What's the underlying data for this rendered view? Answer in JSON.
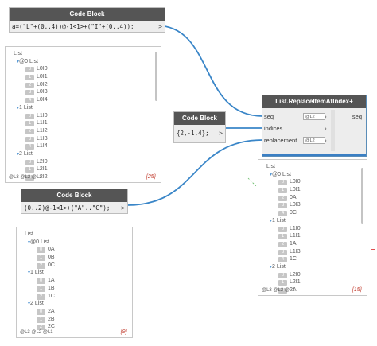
{
  "nodes": {
    "cb1": {
      "title": "Code Block",
      "code": "a=(\"L\"+(0..4))@-1<1>+(\"I\"+(0..4));",
      "output_arrow": ">",
      "preview": {
        "rows": [
          {
            "kind": "list",
            "level": 0,
            "label": "List",
            "index": ""
          },
          {
            "kind": "list",
            "level": 1,
            "label": "List",
            "index": "@0"
          },
          {
            "kind": "item",
            "level": 2,
            "index": "0",
            "value": "L0I0"
          },
          {
            "kind": "item",
            "level": 2,
            "index": "1",
            "value": "L0I1"
          },
          {
            "kind": "item",
            "level": 2,
            "index": "2",
            "value": "L0I2"
          },
          {
            "kind": "item",
            "level": 2,
            "index": "3",
            "value": "L0I3"
          },
          {
            "kind": "item",
            "level": 2,
            "index": "4",
            "value": "L0I4"
          },
          {
            "kind": "list",
            "level": 1,
            "label": "List",
            "index": "1"
          },
          {
            "kind": "item",
            "level": 2,
            "index": "0",
            "value": "L1I0"
          },
          {
            "kind": "item",
            "level": 2,
            "index": "1",
            "value": "L1I1"
          },
          {
            "kind": "item",
            "level": 2,
            "index": "2",
            "value": "L1I2"
          },
          {
            "kind": "item",
            "level": 2,
            "index": "3",
            "value": "L1I3"
          },
          {
            "kind": "item",
            "level": 2,
            "index": "4",
            "value": "L1I4"
          },
          {
            "kind": "list",
            "level": 1,
            "label": "List",
            "index": "2"
          },
          {
            "kind": "item",
            "level": 2,
            "index": "0",
            "value": "L2I0"
          },
          {
            "kind": "item",
            "level": 2,
            "index": "1",
            "value": "L2I1"
          },
          {
            "kind": "item",
            "level": 2,
            "index": "2",
            "value": "L2I2"
          }
        ],
        "levels": "@L3 @L2 @L1",
        "count": "{25}"
      }
    },
    "cb2": {
      "title": "Code Block",
      "code": "{2,-1,4};",
      "output_arrow": ">"
    },
    "cb3": {
      "title": "Code Block",
      "code": "(0..2)@-1<1>+(\"A\"..\"C\");",
      "output_arrow": ">",
      "preview": {
        "rows": [
          {
            "kind": "list",
            "level": 0,
            "label": "List",
            "index": ""
          },
          {
            "kind": "list",
            "level": 1,
            "label": "List",
            "index": "@0"
          },
          {
            "kind": "item",
            "level": 2,
            "index": "0",
            "value": "0A"
          },
          {
            "kind": "item",
            "level": 2,
            "index": "1",
            "value": "0B"
          },
          {
            "kind": "item",
            "level": 2,
            "index": "2",
            "value": "0C"
          },
          {
            "kind": "list",
            "level": 1,
            "label": "List",
            "index": "1"
          },
          {
            "kind": "item",
            "level": 2,
            "index": "0",
            "value": "1A"
          },
          {
            "kind": "item",
            "level": 2,
            "index": "1",
            "value": "1B"
          },
          {
            "kind": "item",
            "level": 2,
            "index": "2",
            "value": "1C"
          },
          {
            "kind": "list",
            "level": 1,
            "label": "List",
            "index": "2"
          },
          {
            "kind": "item",
            "level": 2,
            "index": "0",
            "value": "2A"
          },
          {
            "kind": "item",
            "level": 2,
            "index": "1",
            "value": "2B"
          },
          {
            "kind": "item",
            "level": 2,
            "index": "2",
            "value": "2C"
          }
        ],
        "levels": "@L3 @L2 @L1",
        "count": "{9}"
      }
    },
    "replace": {
      "title": "List.ReplaceItemAtIndex+",
      "inputs": [
        {
          "name": "seq",
          "lacing": "@L2"
        },
        {
          "name": "indices",
          "lacing": ""
        },
        {
          "name": "replacement",
          "lacing": "@L2"
        }
      ],
      "output": "seq",
      "preview": {
        "rows": [
          {
            "kind": "list",
            "level": 0,
            "label": "List",
            "index": ""
          },
          {
            "kind": "list",
            "level": 1,
            "label": "List",
            "index": "@0"
          },
          {
            "kind": "item",
            "level": 2,
            "index": "0",
            "value": "L0I0"
          },
          {
            "kind": "item",
            "level": 2,
            "index": "1",
            "value": "L0I1"
          },
          {
            "kind": "item",
            "level": 2,
            "index": "2",
            "value": "0A"
          },
          {
            "kind": "item",
            "level": 2,
            "index": "3",
            "value": "L0I3"
          },
          {
            "kind": "item",
            "level": 2,
            "index": "4",
            "value": "0C"
          },
          {
            "kind": "list",
            "level": 1,
            "label": "List",
            "index": "1"
          },
          {
            "kind": "item",
            "level": 2,
            "index": "0",
            "value": "L1I0"
          },
          {
            "kind": "item",
            "level": 2,
            "index": "1",
            "value": "L1I1"
          },
          {
            "kind": "item",
            "level": 2,
            "index": "2",
            "value": "1A"
          },
          {
            "kind": "item",
            "level": 2,
            "index": "3",
            "value": "L1I3"
          },
          {
            "kind": "item",
            "level": 2,
            "index": "4",
            "value": "1C"
          },
          {
            "kind": "list",
            "level": 1,
            "label": "List",
            "index": "2"
          },
          {
            "kind": "item",
            "level": 2,
            "index": "0",
            "value": "L2I0"
          },
          {
            "kind": "item",
            "level": 2,
            "index": "1",
            "value": "L2I1"
          },
          {
            "kind": "item",
            "level": 2,
            "index": "2",
            "value": "2A"
          }
        ],
        "levels": "@L3 @L2 @L1",
        "count": "{15}"
      }
    }
  },
  "colors": {
    "wire": "#3a86c8",
    "title_bar": "#555555",
    "node_body": "#ededed",
    "count_text": "#c0392b",
    "selected_border": "#5a8db8"
  }
}
